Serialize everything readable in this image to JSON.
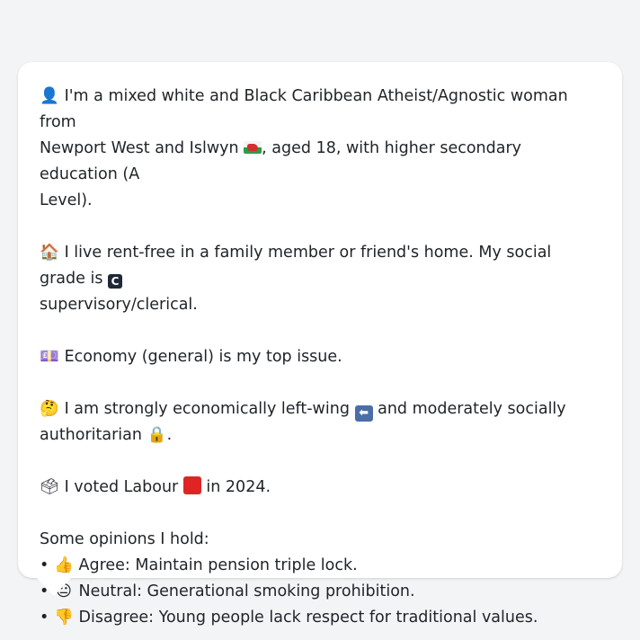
{
  "profile": {
    "identity": {
      "icon": "person-icon",
      "part1": "I'm a mixed white and Black Caribbean Atheist/Agnostic woman from",
      "part2": "Newport West and Islwyn",
      "flag_icon": "wales-flag-icon",
      "part3": ", aged 18, with higher secondary education (A",
      "part4": "Level)."
    },
    "housing": {
      "icon": "house-icon",
      "part1": "I live rent-free in a family member or friend's home. My social grade is",
      "grade_badge": "C",
      "part2": "supervisory/clerical."
    },
    "issue": {
      "icon": "banknote-icon",
      "text": "Economy (general) is my top issue."
    },
    "ideology": {
      "icon": "thinking-face-icon",
      "part1": "I am strongly economically left-wing",
      "left_arrow_icon": "left-arrow-icon",
      "part2": "and moderately socially",
      "part3": "authoritarian",
      "lock_icon": "lock-icon",
      "part4": "."
    },
    "vote": {
      "icon": "ballot-box-icon",
      "part1": "I voted Labour",
      "party_color_icon": "red-square-icon",
      "part2": "in 2024."
    },
    "opinions": {
      "heading": "Some opinions I hold:",
      "items": [
        {
          "bullet": "•",
          "icon": "thumbs-up-icon",
          "text": "Agree: Maintain pension triple lock."
        },
        {
          "bullet": "•",
          "icon": "neutral-face-icon",
          "text": "Neutral: Generational smoking prohibition."
        },
        {
          "bullet": "•",
          "icon": "thumbs-down-icon",
          "text": "Disagree: Young people lack respect for traditional values."
        }
      ]
    }
  },
  "colors": {
    "background": "#f3f4f6",
    "card": "#ffffff",
    "text": "#1f2328",
    "labour_red": "#e02424"
  }
}
